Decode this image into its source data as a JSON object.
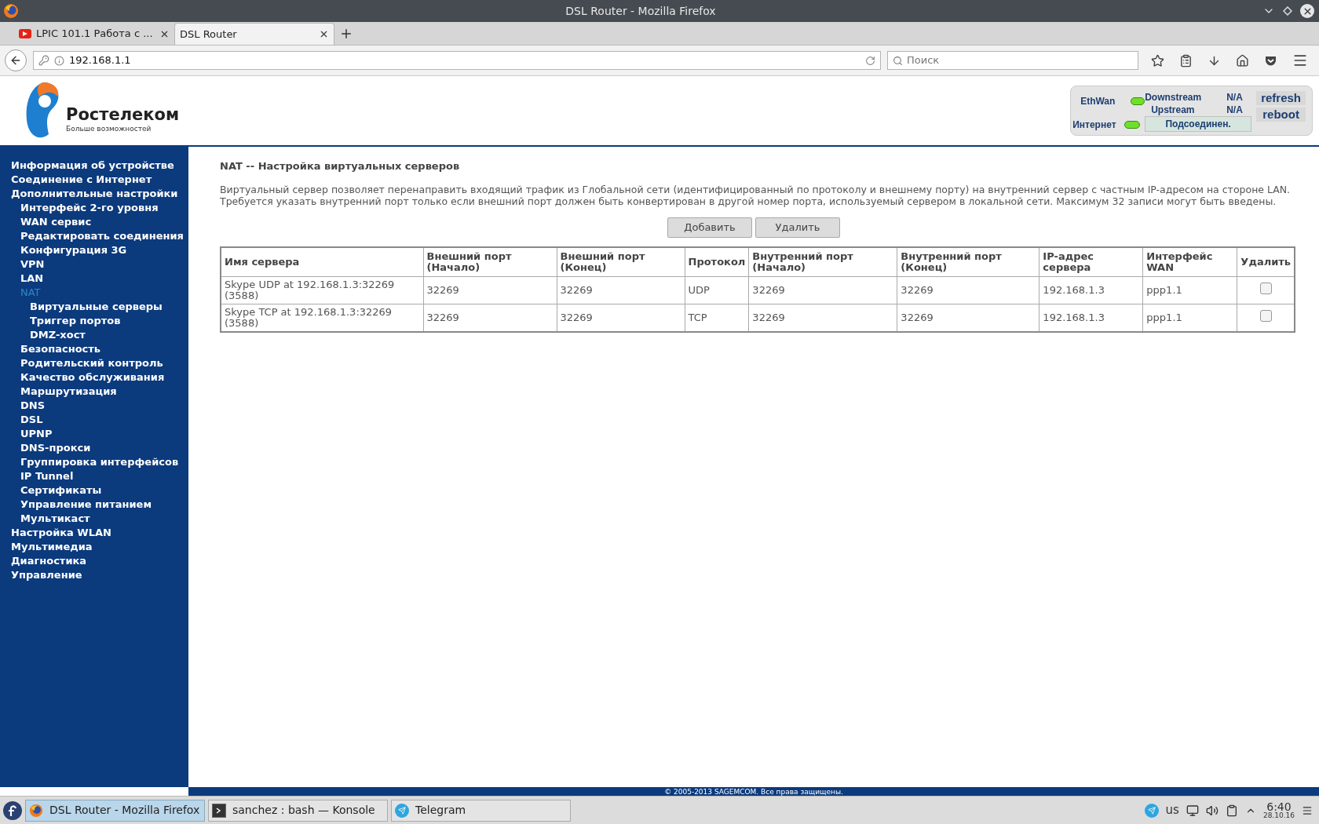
{
  "window": {
    "title": "DSL Router - Mozilla Firefox"
  },
  "tabs": [
    {
      "label": "LPIC 101.1 Работа с ...",
      "selected": false,
      "kind": "video"
    },
    {
      "label": "DSL Router",
      "selected": true,
      "kind": "page"
    }
  ],
  "address_bar": {
    "url": "192.168.1.1"
  },
  "search": {
    "placeholder": "Поиск"
  },
  "header": {
    "logo": {
      "name": "Ростелеком",
      "tagline": "Больше возможностей"
    },
    "status": {
      "ethwan": {
        "label": "EthWan",
        "lit": true
      },
      "downstream": {
        "label": "Downstream",
        "value": "N/A"
      },
      "upstream": {
        "label": "Upstream",
        "value": "N/A"
      },
      "internet": {
        "label": "Интернет",
        "lit": true,
        "state": "Подсоединен."
      },
      "buttons": [
        "refresh",
        "reboot"
      ]
    }
  },
  "sidebar": {
    "items": [
      {
        "label": "Информация об устройстве",
        "selected": false
      },
      {
        "label": "Соединение с Интернет",
        "selected": false
      },
      {
        "label": "Дополнительные настройки",
        "selected": false,
        "children": [
          {
            "label": "Интерфейс 2-го уровня",
            "selected": false
          },
          {
            "label": "WAN сервис",
            "selected": false
          },
          {
            "label": "Редактировать соединения",
            "selected": false
          },
          {
            "label": "Конфигурация 3G",
            "selected": false
          },
          {
            "label": "VPN",
            "selected": false
          },
          {
            "label": "LAN",
            "selected": false
          },
          {
            "label": "NAT",
            "selected": true,
            "children": [
              {
                "label": "Виртуальные серверы",
                "selected": false
              },
              {
                "label": "Триггер портов",
                "selected": false
              },
              {
                "label": "DMZ-хост",
                "selected": false
              }
            ]
          },
          {
            "label": "Безопасность",
            "selected": false
          },
          {
            "label": "Родительский контроль",
            "selected": false
          },
          {
            "label": "Качество обслуживания",
            "selected": false
          },
          {
            "label": "Маршрутизация",
            "selected": false
          },
          {
            "label": "DNS",
            "selected": false
          },
          {
            "label": "DSL",
            "selected": false
          },
          {
            "label": "UPNP",
            "selected": false
          },
          {
            "label": "DNS-прокси",
            "selected": false
          },
          {
            "label": "Группировка интерфейсов",
            "selected": false
          },
          {
            "label": "IP Tunnel",
            "selected": false
          },
          {
            "label": "Сертификаты",
            "selected": false
          },
          {
            "label": "Управление питанием",
            "selected": false
          },
          {
            "label": "Мультикаст",
            "selected": false
          }
        ]
      },
      {
        "label": "Настройка WLAN",
        "selected": false
      },
      {
        "label": "Мультимедиа",
        "selected": false
      },
      {
        "label": "Диагностика",
        "selected": false
      },
      {
        "label": "Управление",
        "selected": false
      }
    ]
  },
  "content": {
    "title": "NAT -- Настройка виртуальных серверов",
    "description": [
      "Виртуальный сервер позволяет перенаправить входящий трафик из Глобальной сети (идентифицированный по протоколу и внешнему порту) на внутренний сервер с частным IP-адресом на стороне LAN.",
      "Требуется указать внутренний порт только если внешний порт должен быть конвертирован в другой номер порта, используемый сервером в локальной сети. Максимум 32 записи могут быть введены."
    ],
    "buttons": [
      "Добавить",
      "Удалить"
    ],
    "table": {
      "columns": [
        "Имя сервера",
        "Внешний порт (Начало)",
        "Внешний порт (Конец)",
        "Протокол",
        "Внутренний порт (Начало)",
        "Внутренний порт (Конец)",
        "IP-адрес сервера",
        "Интерфейс WAN",
        "Удалить"
      ],
      "rows": [
        {
          "cells": [
            "Skype UDP at 192.168.1.3:32269 (3588)",
            "32269",
            "32269",
            "UDP",
            "32269",
            "32269",
            "192.168.1.3",
            "ppp1.1"
          ],
          "checked": false
        },
        {
          "cells": [
            "Skype TCP at 192.168.1.3:32269 (3588)",
            "32269",
            "32269",
            "TCP",
            "32269",
            "32269",
            "192.168.1.3",
            "ppp1.1"
          ],
          "checked": false
        }
      ]
    }
  },
  "footer": {
    "copyright": "© 2005-2013 SAGEMCOM. Все права защищены."
  },
  "taskbar": {
    "tasks": [
      {
        "label": "DSL Router - Mozilla Firefox",
        "selected": true,
        "kind": "firefox"
      },
      {
        "label": "sanchez : bash — Konsole",
        "selected": false,
        "kind": "terminal"
      },
      {
        "label": "Telegram",
        "selected": false,
        "kind": "telegram"
      }
    ],
    "keyboard_layout": "us",
    "time": "6:40",
    "date": "28.10.16"
  }
}
